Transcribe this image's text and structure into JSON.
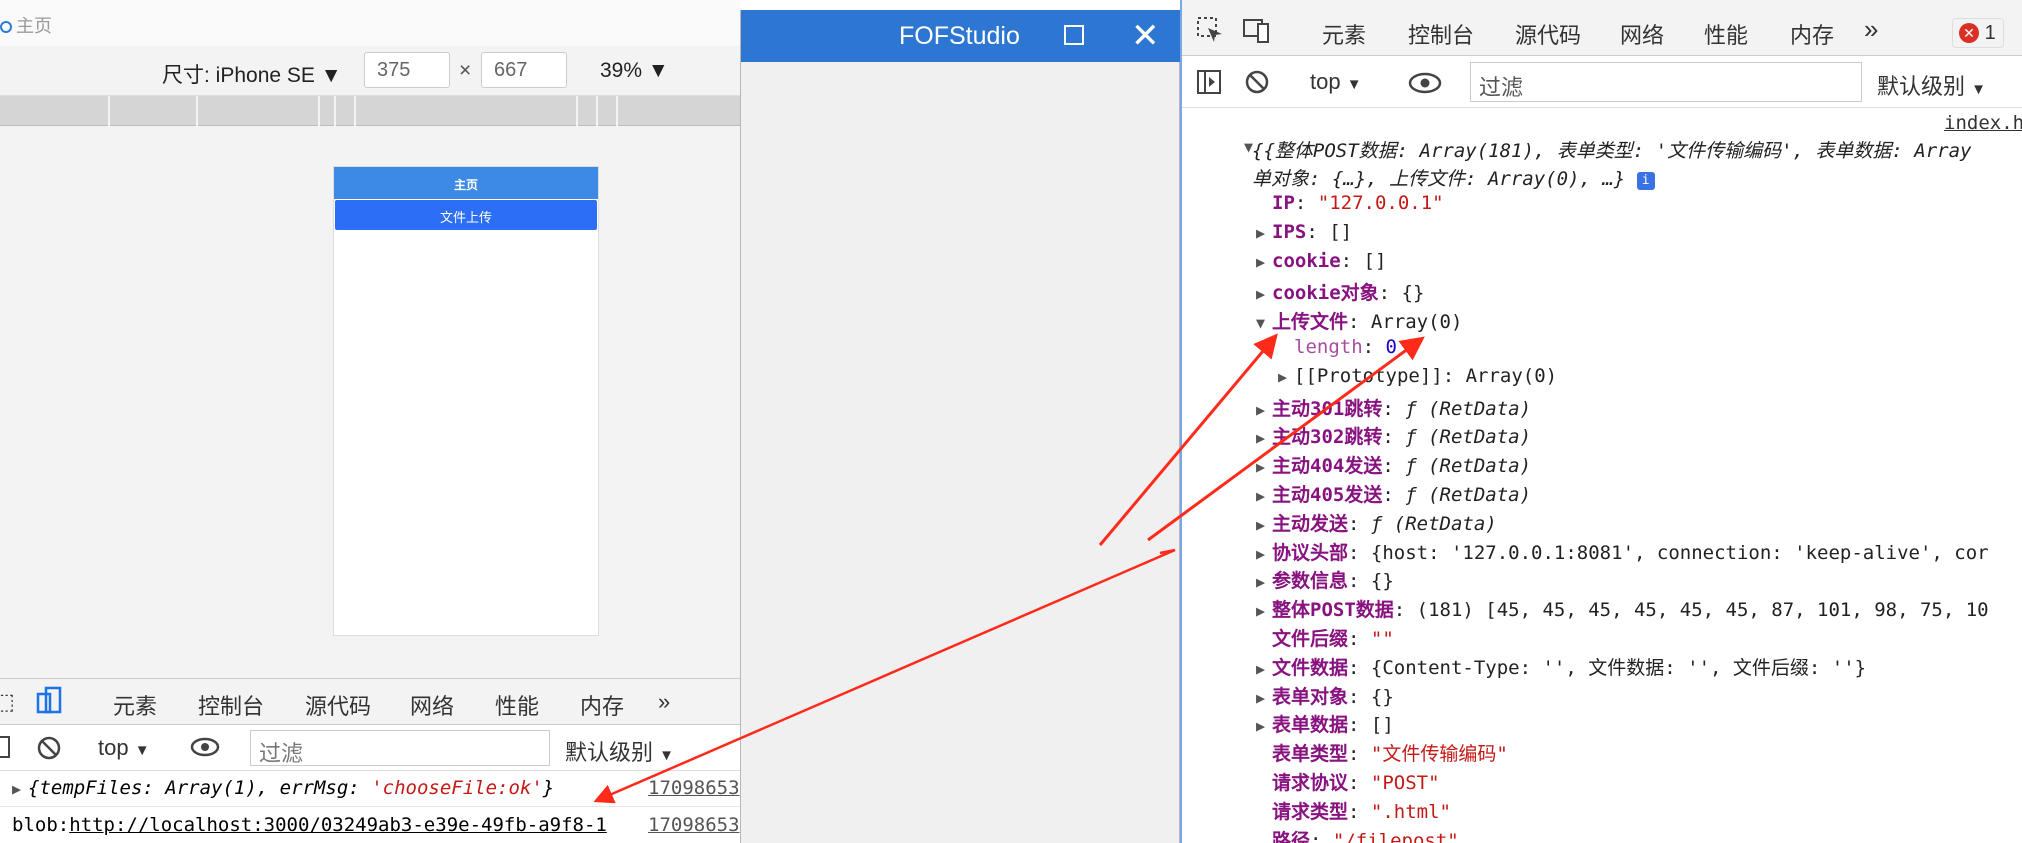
{
  "left": {
    "window_title": "主页",
    "device_label": "尺寸: iPhone SE",
    "width_value": "375",
    "times": "×",
    "height_value": "667",
    "zoom": "39%",
    "phone": {
      "header": "主页",
      "upload_button": "文件上传"
    },
    "devtools": {
      "tabs": [
        "元素",
        "控制台",
        "源代码",
        "网络",
        "性能",
        "内存"
      ],
      "active_tab": "控制台",
      "context": "top",
      "filter_placeholder": "过滤",
      "level": "默认级别",
      "log": [
        {
          "prefix": "{",
          "text": "tempFiles: Array(1), errMsg: ",
          "str": "'chooseFile:ok'",
          "suffix": "}",
          "timestamp": "17098653"
        },
        {
          "prefix": "blob:",
          "text": "http://localhost:3000/03249ab3-e39e-49fb-a9f8-1",
          "timestamp": "17098653"
        }
      ]
    }
  },
  "middle": {
    "title": "FOFStudio"
  },
  "right": {
    "tabs": [
      "元素",
      "控制台",
      "源代码",
      "网络",
      "性能",
      "内存"
    ],
    "active_tab": "控制台",
    "error_count": "1",
    "context": "top",
    "filter_placeholder": "过滤",
    "level": "默认级别",
    "source_link": "index.h",
    "summary_line1": "{整体POST数据: Array(181), 表单类型: '文件传输编码', 表单数据: Array",
    "summary_line2": "单对象: {…}, 上传文件: Array(0), …}",
    "props": [
      {
        "name": "IP",
        "sep": ": ",
        "value": "\"127.0.0.1\"",
        "kind": "str",
        "expand": ""
      },
      {
        "name": "IPS",
        "sep": ": ",
        "value": "[]",
        "kind": "plain",
        "expand": "▶"
      },
      {
        "name": "cookie",
        "sep": ": ",
        "value": "[]",
        "kind": "plain",
        "expand": "▶"
      },
      {
        "name": "cookie对象",
        "sep": ": ",
        "value": "{}",
        "kind": "plain",
        "expand": "▶"
      },
      {
        "name": "上传文件",
        "sep": ": ",
        "value": "Array(0)",
        "kind": "plain",
        "expand": "▼"
      },
      {
        "name": "length",
        "sep": ": ",
        "value": "0",
        "kind": "num",
        "expand": "",
        "indent": true,
        "light": true
      },
      {
        "name": "[[Prototype]]",
        "sep": ": ",
        "value": "Array(0)",
        "kind": "plain",
        "expand": "▶",
        "indent": true,
        "plainname": true
      },
      {
        "name": "主动301跳转",
        "sep": ": ",
        "value": "ƒ (RetData)",
        "kind": "fn",
        "expand": "▶"
      },
      {
        "name": "主动302跳转",
        "sep": ": ",
        "value": "ƒ (RetData)",
        "kind": "fn",
        "expand": "▶"
      },
      {
        "name": "主动404发送",
        "sep": ": ",
        "value": "ƒ (RetData)",
        "kind": "fn",
        "expand": "▶"
      },
      {
        "name": "主动405发送",
        "sep": ": ",
        "value": "ƒ (RetData)",
        "kind": "fn",
        "expand": "▶"
      },
      {
        "name": "主动发送",
        "sep": ": ",
        "value": "ƒ (RetData)",
        "kind": "fn",
        "expand": "▶"
      },
      {
        "name": "协议头部",
        "sep": ": ",
        "value": "{host: '127.0.0.1:8081', connection: 'keep-alive', cor",
        "kind": "mixed",
        "expand": "▶"
      },
      {
        "name": "参数信息",
        "sep": ": ",
        "value": "{}",
        "kind": "plain",
        "expand": "▶"
      },
      {
        "name": "整体POST数据",
        "sep": ": ",
        "value": "(181) [45, 45, 45, 45, 45, 45, 87, 101, 98, 75, 10",
        "kind": "plain",
        "expand": "▶"
      },
      {
        "name": "文件后缀",
        "sep": ": ",
        "value": "\"\"",
        "kind": "str",
        "expand": ""
      },
      {
        "name": "文件数据",
        "sep": ": ",
        "value": "{Content-Type: '', 文件数据: '', 文件后缀: ''}",
        "kind": "plain",
        "expand": "▶"
      },
      {
        "name": "表单对象",
        "sep": ": ",
        "value": "{}",
        "kind": "plain",
        "expand": "▶"
      },
      {
        "name": "表单数据",
        "sep": ": ",
        "value": "[]",
        "kind": "plain",
        "expand": "▶"
      },
      {
        "name": "表单类型",
        "sep": ": ",
        "value": "\"文件传输编码\"",
        "kind": "str",
        "expand": ""
      },
      {
        "name": "请求协议",
        "sep": ": ",
        "value": "\"POST\"",
        "kind": "str",
        "expand": ""
      },
      {
        "name": "请求类型",
        "sep": ": ",
        "value": "\".html\"",
        "kind": "str",
        "expand": ""
      },
      {
        "name": "路径",
        "sep": ": ",
        "value": "\"/filepost\"",
        "kind": "str",
        "expand": ""
      }
    ]
  },
  "colors": {
    "accent": "#1a73e8",
    "title_bar": "#2d77d2",
    "arrow": "#ff2a1a",
    "string": "#c41a16",
    "key": "#881280"
  }
}
